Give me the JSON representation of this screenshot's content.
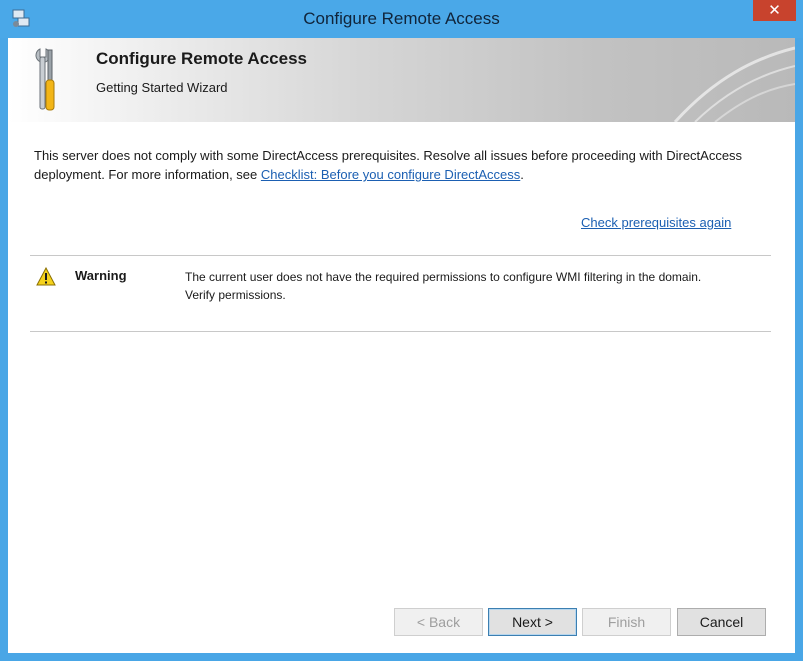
{
  "window": {
    "title": "Configure Remote Access",
    "close_label": "✕"
  },
  "banner": {
    "title": "Configure Remote Access",
    "subtitle": "Getting Started Wizard"
  },
  "message": {
    "text": "This server does not comply with some DirectAccess prerequisites. Resolve all issues before proceeding with DirectAccess deployment. For more information, see ",
    "link": "Checklist: Before you configure DirectAccess",
    "suffix": "."
  },
  "recheck_link": "Check prerequisites again",
  "issues": [
    {
      "severity": "Warning",
      "icon": "warning-icon",
      "text": "The current user does not have the required permissions to configure WMI filtering in the domain. Verify permissions."
    }
  ],
  "buttons": {
    "back": "< Back",
    "next": "Next >",
    "finish": "Finish",
    "cancel": "Cancel"
  },
  "colors": {
    "titlebar": "#4aa8e8",
    "close": "#c8432d",
    "link": "#1b5fb2",
    "warning": "#f5d21c"
  }
}
